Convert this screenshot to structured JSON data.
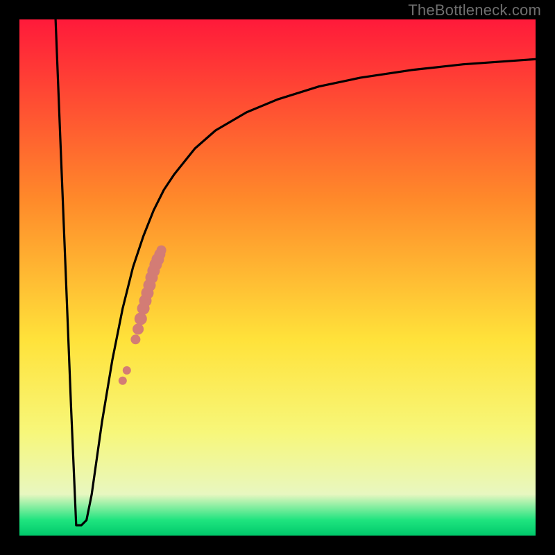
{
  "watermark": "TheBottleneck.com",
  "colors": {
    "frame": "#000000",
    "curve": "#000000",
    "dots": "#d37c75",
    "gradient_top": "#ff1a3a",
    "gradient_mid_upper": "#ff8a2a",
    "gradient_mid": "#ffe23a",
    "gradient_mid_lower": "#f7f77a",
    "gradient_pale": "#e8f7c0",
    "gradient_green": "#1fe47f",
    "gradient_deep_green": "#00c96b"
  },
  "chart_data": {
    "type": "line",
    "title": "",
    "xlabel": "",
    "ylabel": "",
    "xlim": [
      0,
      100
    ],
    "ylim": [
      0,
      100
    ],
    "series": [
      {
        "name": "bottleneck-curve",
        "x": [
          7,
          8,
          9,
          10,
          11,
          12,
          13,
          14,
          15,
          16,
          18,
          20,
          22,
          24,
          26,
          28,
          30,
          34,
          38,
          44,
          50,
          58,
          66,
          76,
          86,
          100
        ],
        "y": [
          100,
          75,
          50,
          25,
          2,
          2,
          3,
          8,
          15,
          22,
          34,
          44,
          52,
          58,
          63,
          67,
          70,
          75,
          78.5,
          82,
          84.5,
          87,
          88.7,
          90.2,
          91.3,
          92.3
        ]
      }
    ],
    "dots": {
      "name": "highlighted-points",
      "x": [
        20.0,
        20.8,
        22.5,
        23.0,
        23.5,
        24.0,
        24.4,
        24.8,
        25.2,
        25.6,
        26.0,
        26.4,
        26.8,
        27.2,
        27.5
      ],
      "y": [
        30.0,
        32.0,
        38.0,
        40.0,
        42.0,
        44.0,
        45.5,
        47.0,
        48.5,
        50.0,
        51.3,
        52.5,
        53.5,
        54.5,
        55.3
      ],
      "r": [
        6,
        6,
        7,
        8,
        9,
        9,
        9,
        9,
        9,
        9,
        9,
        9,
        9,
        8,
        7
      ]
    }
  }
}
